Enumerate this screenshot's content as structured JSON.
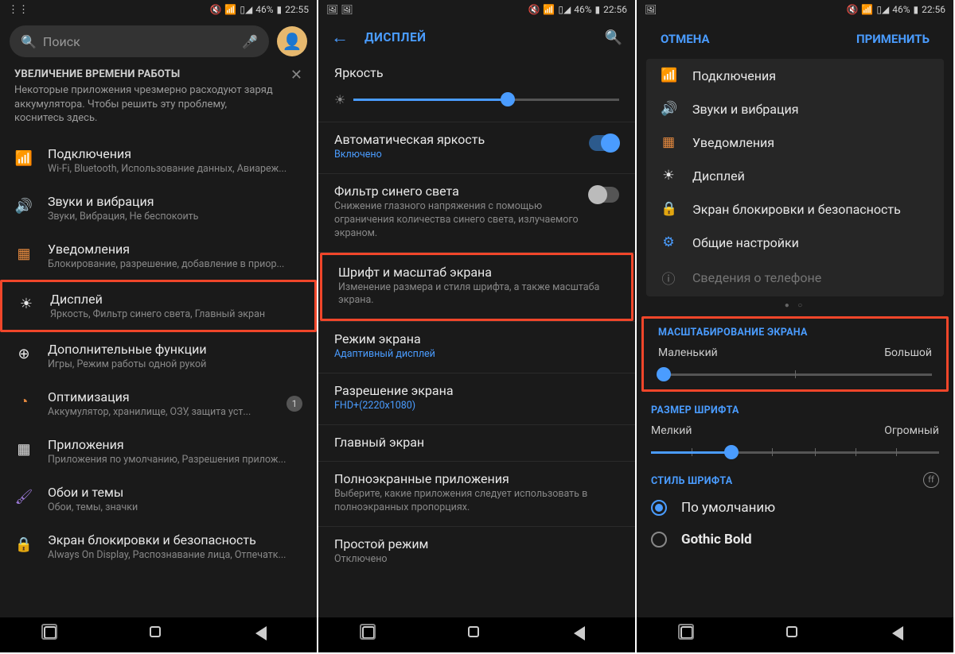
{
  "statusbar": {
    "battery": "46%",
    "time1": "22:55",
    "time2": "22:56",
    "time3": "22:56"
  },
  "screen1": {
    "search_placeholder": "Поиск",
    "tip": {
      "title": "УВЕЛИЧЕНИЕ ВРЕМЕНИ РАБОТЫ",
      "text": "Некоторые приложения чрезмерно расходуют заряд аккумулятора. Чтобы решить эту проблему, коснитесь здесь."
    },
    "items": [
      {
        "title": "Подключения",
        "sub": "Wi-Fi, Bluetooth, Использование данных, Авиареж...",
        "icon": "📶",
        "cls": "c-blue"
      },
      {
        "title": "Звуки и вибрация",
        "sub": "Звуки, Вибрация, Не беспокоить",
        "icon": "🔊",
        "cls": "c-teal"
      },
      {
        "title": "Уведомления",
        "sub": "Блокирование, разрешение, добавление в приор...",
        "icon": "▦",
        "cls": "c-orange"
      },
      {
        "title": "Дисплей",
        "sub": "Яркость, Фильтр синего света, Главный экран",
        "icon": "☀",
        "cls": ""
      },
      {
        "title": "Дополнительные функции",
        "sub": "Игры, Режим работы одной рукой",
        "icon": "⊕",
        "cls": ""
      },
      {
        "title": "Оптимизация",
        "sub": "Аккумулятор, хранилище, ОЗУ, защита уст...",
        "icon": "◔",
        "cls": "c-orange",
        "badge": "1"
      },
      {
        "title": "Приложения",
        "sub": "Приложения по умолчанию, Разрешения прилож...",
        "icon": "▦",
        "cls": ""
      },
      {
        "title": "Обои и темы",
        "sub": "Обои, темы, значки",
        "icon": "🖌",
        "cls": "c-purple"
      },
      {
        "title": "Экран блокировки и безопасность",
        "sub": "Always On Display, Распознавание лица, Отпечатк...",
        "icon": "🔒",
        "cls": "c-greenish"
      }
    ]
  },
  "screen2": {
    "header": "ДИСПЛЕЙ",
    "brightness_title": "Яркость",
    "auto_brightness": {
      "title": "Автоматическая яркость",
      "sub": "Включено"
    },
    "blue_filter": {
      "title": "Фильтр синего света",
      "sub": "Снижение глазного напряжения с помощью ограничения количества синего света, излучаемого экраном."
    },
    "font_scale": {
      "title": "Шрифт и масштаб экрана",
      "sub": "Изменение размера и стиля шрифта, а также масштаба экрана."
    },
    "screen_mode": {
      "title": "Режим экрана",
      "sub": "Адаптивный дисплей"
    },
    "resolution": {
      "title": "Разрешение экрана",
      "sub": "FHD+(2220x1080)"
    },
    "home_screen": {
      "title": "Главный экран"
    },
    "fullscreen_apps": {
      "title": "Полноэкранные приложения",
      "sub": "Выберите, какие приложения следует использовать в полноэкранных пропорциях."
    },
    "easy_mode": {
      "title": "Простой режим",
      "sub": "Отключено"
    }
  },
  "screen3": {
    "cancel": "ОТМЕНА",
    "apply": "ПРИМЕНИТЬ",
    "cats": [
      {
        "label": "Подключения",
        "icon": "📶",
        "cls": "c-blue"
      },
      {
        "label": "Звуки и вибрация",
        "icon": "🔊",
        "cls": "c-teal"
      },
      {
        "label": "Уведомления",
        "icon": "▦",
        "cls": "c-orange"
      },
      {
        "label": "Дисплей",
        "icon": "☀",
        "cls": ""
      },
      {
        "label": "Экран блокировки и безопасность",
        "icon": "🔒",
        "cls": "c-greenish"
      },
      {
        "label": "Общие настройки",
        "icon": "⚙",
        "cls": "c-blue"
      },
      {
        "label": "Сведения о телефоне",
        "icon": "ⓘ",
        "cls": ""
      }
    ],
    "screen_scale": {
      "label": "МАСШТАБИРОВАНИЕ ЭКРАНА",
      "min": "Маленький",
      "max": "Большой"
    },
    "font_size": {
      "label": "РАЗМЕР ШРИФТА",
      "min": "Мелкий",
      "max": "Огромный"
    },
    "font_style": {
      "label": "СТИЛЬ ШРИФТА",
      "opt1": "По умолчанию",
      "opt2": "Gothic Bold"
    }
  }
}
